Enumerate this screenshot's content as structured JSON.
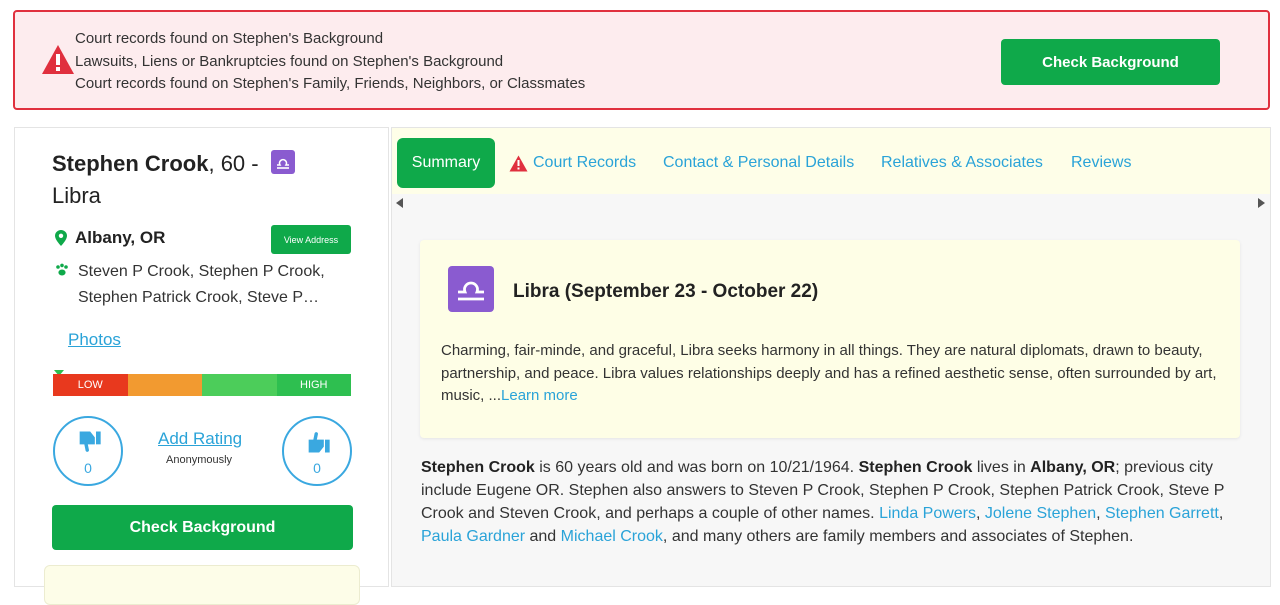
{
  "alert": {
    "lines": [
      "Court records found on Stephen's Background",
      "Lawsuits, Liens or Bankruptcies found on Stephen's Background",
      "Court records found on Stephen's Family, Friends, Neighbors, or Classmates"
    ],
    "button_label": "Check Background",
    "border_color": "#e0303e",
    "icon": "warning-triangle-icon"
  },
  "profile": {
    "name": "Stephen Crook",
    "age_suffix": ", 60 -",
    "sign": "Libra",
    "location": "Albany, OR",
    "view_address_label": "View Address",
    "aliases": "Steven P Crook, Stephen P Crook, Stephen Patrick Crook, Steve P…",
    "photos_label": "Photos",
    "rating_scale": {
      "low_label": "LOW",
      "high_label": "HIGH"
    },
    "dislike_count": "0",
    "like_count": "0",
    "add_rating_label": "Add Rating",
    "anonymously_label": "Anonymously",
    "check_background_label": "Check Background"
  },
  "tabs": {
    "summary": "Summary",
    "court_records": "Court Records",
    "contact": "Contact & Personal Details",
    "relatives": "Relatives & Associates",
    "reviews": "Reviews"
  },
  "zodiac_card": {
    "title": "Libra (September 23 - October 22)",
    "description": "Charming, fair-minde, and graceful, Libra seeks harmony in all things. They are natural diplomats, drawn to beauty, partnership, and peace. Libra values relationships deeply and has a refined aesthetic sense, often surrounded by art, music, ...",
    "learn_more": "Learn more"
  },
  "bio": {
    "name": "Stephen Crook",
    "p1": " is 60 years old and was born on 10/21/1964. ",
    "p2": " lives in ",
    "city": "Albany, OR",
    "p3": "; previous city include Eugene OR. Stephen also answers to Steven P Crook, Stephen P Crook, Stephen Patrick Crook, Steve P Crook and Steven Crook, and perhaps a couple of other names. ",
    "relatives": [
      "Linda Powers",
      "Jolene Stephen",
      "Stephen Garrett",
      "Paula Gardner",
      "Michael Crook"
    ],
    "sep": ", ",
    "and": " and ",
    "p4": ", and many others are family members and associates of Stephen."
  },
  "colors": {
    "brand_green": "#0fa94a",
    "link_blue": "#2aa3d8",
    "zodiac_purple": "#8a5bd0"
  }
}
